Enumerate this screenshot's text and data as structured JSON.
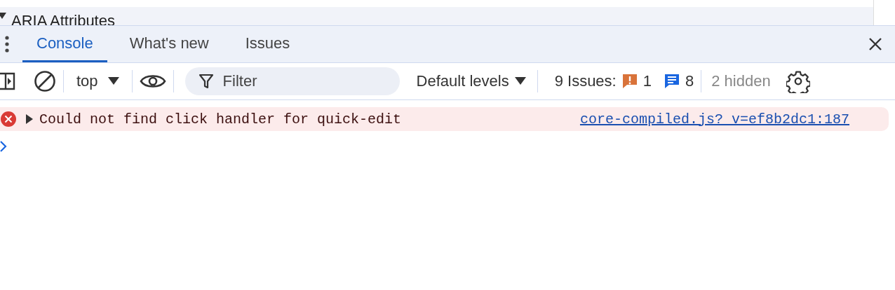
{
  "elements_panel": {
    "section": {
      "label": "ARIA Attributes",
      "expanded": true
    }
  },
  "drawer": {
    "tabs": [
      {
        "label": "Console",
        "selected": true
      },
      {
        "label": "What's new",
        "selected": false
      },
      {
        "label": "Issues",
        "selected": false
      }
    ]
  },
  "toolbar": {
    "context": "top",
    "filter": {
      "placeholder": "Filter"
    },
    "levels": "Default levels",
    "issues": {
      "label": "9 Issues:",
      "warnings": "1",
      "info": "8"
    },
    "hidden": "2 hidden"
  },
  "messages": [
    {
      "kind": "error",
      "text": "Could not find click handler for quick-edit",
      "expanded": false,
      "source": "core-compiled.js?_v=ef8b2dc1:187"
    }
  ]
}
